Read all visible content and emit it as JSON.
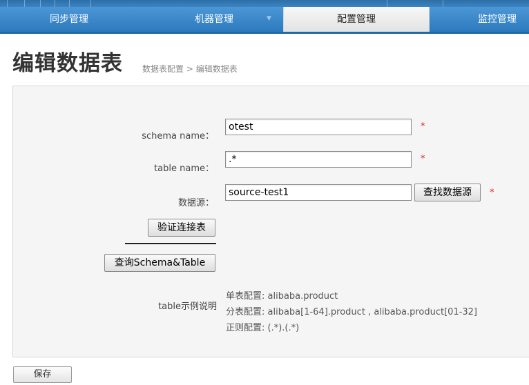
{
  "nav": {
    "items": [
      {
        "label": "同步管理"
      },
      {
        "label": "机器管理"
      },
      {
        "label": "配置管理"
      },
      {
        "label": "监控管理"
      }
    ],
    "active_index": 2
  },
  "page": {
    "title": "编辑数据表",
    "breadcrumb": [
      "数据表配置",
      "编辑数据表"
    ],
    "breadcrumb_separator": ">"
  },
  "form": {
    "schema": {
      "label": "schema name：",
      "value": "otest"
    },
    "table": {
      "label": "table name：",
      "value": ".*"
    },
    "datasource": {
      "label": "数据源：",
      "value": "source-test1",
      "find_button": "查找数据源"
    },
    "required_mark": "*",
    "verify_button": "验证连接表",
    "query_button": "查询Schema&Table",
    "help": {
      "label": "table示例说明",
      "lines": [
        "单表配置: alibaba.product",
        "分表配置: alibaba[1-64].product , alibaba.product[01-32]",
        "正则配置: (.*).(.*)"
      ]
    }
  },
  "actions": {
    "save_label": "保存"
  },
  "colors": {
    "nav_blue": "#3584c7",
    "required": "#e02020"
  }
}
